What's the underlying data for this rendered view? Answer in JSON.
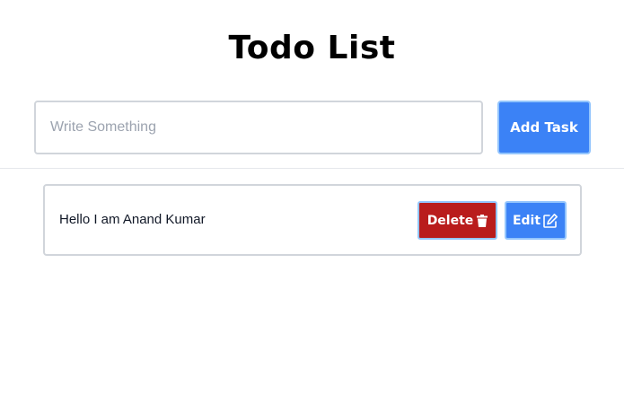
{
  "header": {
    "title": "Todo List"
  },
  "input": {
    "placeholder": "Write Something",
    "value": "",
    "add_label": "Add Task"
  },
  "todos": [
    {
      "text": "Hello I am Anand Kumar",
      "delete_label": "Delete",
      "delete_icon": "trash-icon",
      "edit_label": "Edit",
      "edit_icon": "edit-icon"
    }
  ],
  "colors": {
    "primary": "#3b82f6",
    "danger": "#b91c1c",
    "border": "#d1d5db",
    "focus_border": "#93c5fd",
    "placeholder": "#9ca3af"
  }
}
